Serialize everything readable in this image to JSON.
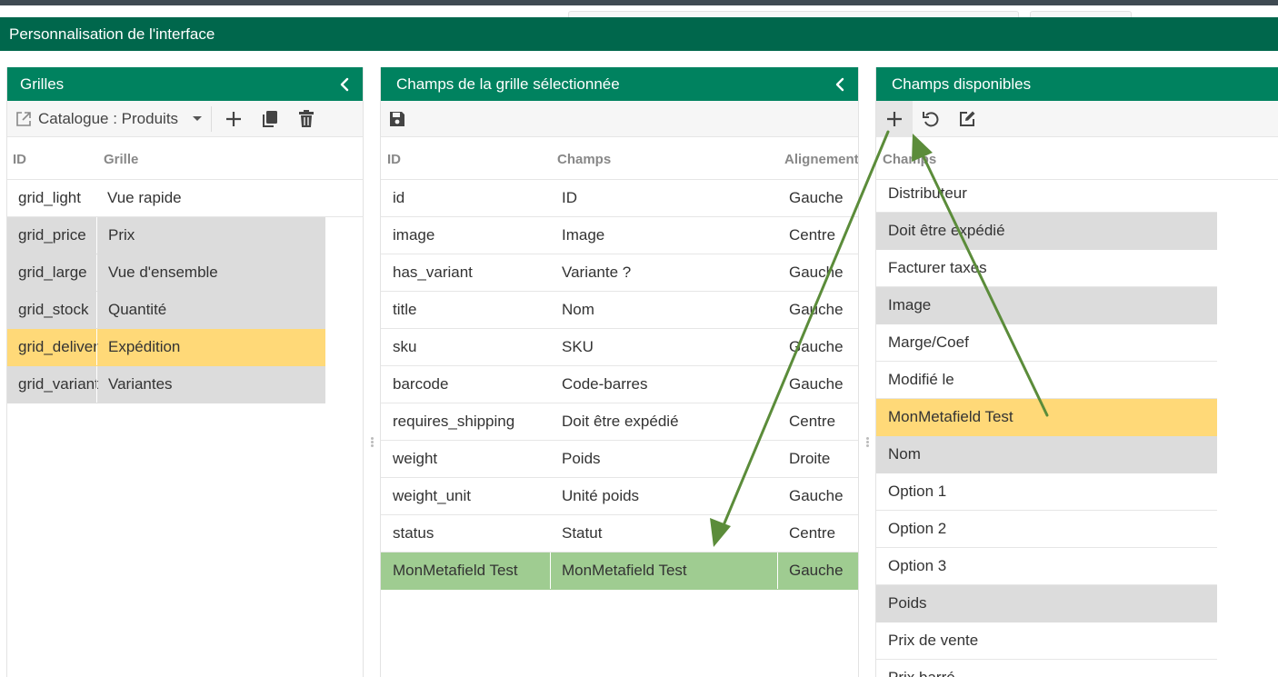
{
  "app": {
    "title": "Personnalisation de l'interface"
  },
  "panels": {
    "grids": {
      "title": "Grilles",
      "select_value": "Catalogue : Produits",
      "columns": [
        "ID",
        "Grille"
      ],
      "rows": [
        {
          "id": "grid_light",
          "name": "Vue rapide",
          "state": "normal"
        },
        {
          "id": "grid_price",
          "name": "Prix",
          "state": "gray"
        },
        {
          "id": "grid_large",
          "name": "Vue d'ensemble",
          "state": "gray"
        },
        {
          "id": "grid_stock",
          "name": "Quantité",
          "state": "gray"
        },
        {
          "id": "grid_delivery",
          "name": "Expédition",
          "state": "selected"
        },
        {
          "id": "grid_variants",
          "name": "Variantes",
          "state": "gray"
        }
      ]
    },
    "fields": {
      "title": "Champs de la grille sélectionnée",
      "columns": [
        "ID",
        "Champs",
        "Alignement"
      ],
      "rows": [
        {
          "id": "id",
          "field": "ID",
          "align": "Gauche",
          "state": "normal"
        },
        {
          "id": "image",
          "field": "Image",
          "align": "Centre",
          "state": "normal"
        },
        {
          "id": "has_variant",
          "field": "Variante ?",
          "align": "Gauche",
          "state": "normal"
        },
        {
          "id": "title",
          "field": "Nom",
          "align": "Gauche",
          "state": "normal"
        },
        {
          "id": "sku",
          "field": "SKU",
          "align": "Gauche",
          "state": "normal"
        },
        {
          "id": "barcode",
          "field": "Code-barres",
          "align": "Gauche",
          "state": "normal"
        },
        {
          "id": "requires_shipping",
          "field": "Doit être expédié",
          "align": "Centre",
          "state": "normal"
        },
        {
          "id": "weight",
          "field": "Poids",
          "align": "Droite",
          "state": "normal"
        },
        {
          "id": "weight_unit",
          "field": "Unité poids",
          "align": "Gauche",
          "state": "normal"
        },
        {
          "id": "status",
          "field": "Statut",
          "align": "Centre",
          "state": "normal"
        },
        {
          "id": "MonMetafield Test",
          "field": "MonMetafield Test",
          "align": "Gauche",
          "state": "added"
        }
      ]
    },
    "available": {
      "title": "Champs disponibles",
      "columns": [
        "Champs"
      ],
      "rows": [
        {
          "field": "Distributeur",
          "state": "normal"
        },
        {
          "field": "Doit être expédié",
          "state": "gray"
        },
        {
          "field": "Facturer taxes",
          "state": "normal"
        },
        {
          "field": "Image",
          "state": "gray"
        },
        {
          "field": "Marge/Coef",
          "state": "normal"
        },
        {
          "field": "Modifié le",
          "state": "normal"
        },
        {
          "field": "MonMetafield Test",
          "state": "selected"
        },
        {
          "field": "Nom",
          "state": "gray"
        },
        {
          "field": "Option 1",
          "state": "normal"
        },
        {
          "field": "Option 2",
          "state": "normal"
        },
        {
          "field": "Option 3",
          "state": "normal"
        },
        {
          "field": "Poids",
          "state": "gray"
        },
        {
          "field": "Prix de vente",
          "state": "normal"
        },
        {
          "field": "Prix barré",
          "state": "normal"
        }
      ]
    }
  },
  "icons": {
    "collapse": "chevron-left-icon",
    "open": "external-link-icon",
    "add": "plus-icon",
    "copy": "copy-icon",
    "delete": "trash-icon",
    "save": "save-icon",
    "reset": "undo-icon",
    "edit": "edit-icon"
  },
  "colors": {
    "title_bar": "#00674c",
    "panel_header": "#00825f",
    "row_gray": "#dcdcdc",
    "row_selected": "#ffd978",
    "row_added": "#9fcc91",
    "arrow": "#5b8c3a"
  }
}
